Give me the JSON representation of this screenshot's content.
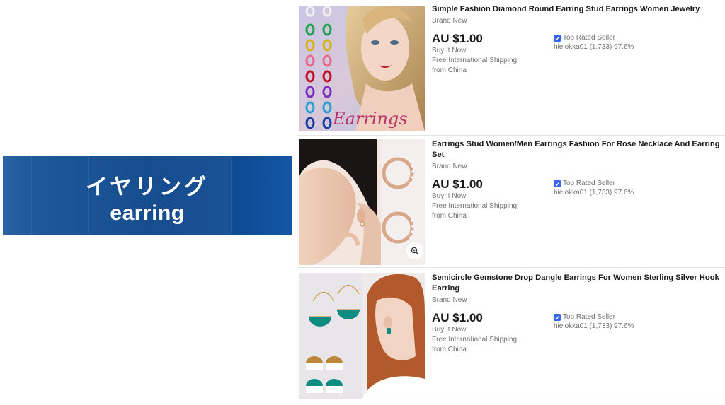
{
  "banner": {
    "japanese": "イヤリング",
    "english": "earring"
  },
  "listings": [
    {
      "title": "Simple Fashion Diamond Round Earring Stud Earrings Women Jewelry",
      "condition": "Brand New",
      "price": "AU $1.00",
      "format": "Buy It Now",
      "shipping_line1": "Free International Shipping",
      "shipping_line2": "from China",
      "seller_badge": "Top Rated Seller",
      "seller_info": "hielokka01 (1,733) 97.6%",
      "image_text": "Earrings"
    },
    {
      "title": "Earrings Stud Women/Men Earrings Fashion For Rose Necklace And Earring Set",
      "condition": "Brand New",
      "price": "AU $1.00",
      "format": "Buy It Now",
      "shipping_line1": "Free International Shipping",
      "shipping_line2": "from China",
      "seller_badge": "Top Rated Seller",
      "seller_info": "hielokka01 (1,733) 97.6%"
    },
    {
      "title": "Semicircle Gemstone Drop Dangle Earrings For Women Sterling Silver Hook Earring",
      "condition": "Brand New",
      "price": "AU $1.00",
      "format": "Buy It Now",
      "shipping_line1": "Free International Shipping",
      "shipping_line2": "from China",
      "seller_badge": "Top Rated Seller",
      "seller_info": "hielokka01 (1,733) 97.6%"
    }
  ],
  "icons": {
    "badge": "top-rated-seller-icon",
    "zoom": "magnify-icon"
  },
  "colors": {
    "banner_blue": "#164d8f",
    "badge_blue": "#3665f3",
    "text_primary": "#191919",
    "text_secondary": "#707070"
  }
}
